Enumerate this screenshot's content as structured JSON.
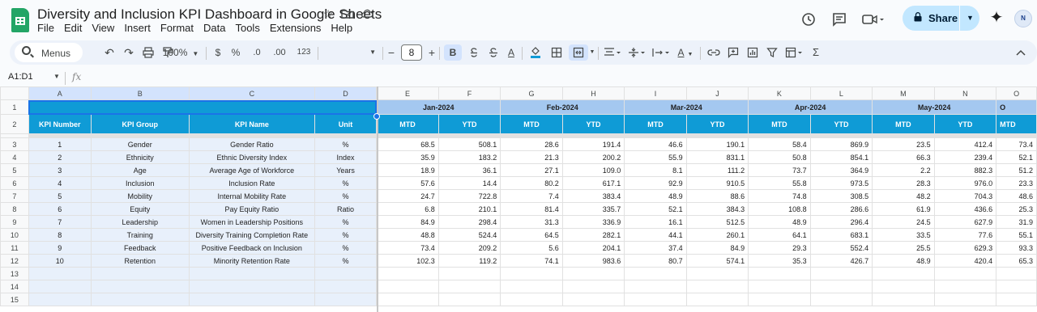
{
  "document": {
    "title": "Diversity and Inclusion KPI Dashboard in Google Sheets"
  },
  "menu": [
    "File",
    "Edit",
    "View",
    "Insert",
    "Format",
    "Data",
    "Tools",
    "Extensions",
    "Help"
  ],
  "share": {
    "label": "Share"
  },
  "avatar": {
    "initials": "N"
  },
  "toolbar": {
    "search_label": "Menus",
    "zoom": "100%",
    "currency": "$",
    "percent": "%",
    "decrease_decimal": ".0",
    "increase_decimal": ".00",
    "number_format": "123",
    "font_size": "8",
    "minus": "−",
    "plus": "+",
    "bold": "B",
    "text_color": "A"
  },
  "formula_bar": {
    "name_box": "A1:D1",
    "fx": "fx"
  },
  "columns": [
    "A",
    "B",
    "C",
    "D",
    "E",
    "F",
    "G",
    "H",
    "I",
    "J",
    "K",
    "L",
    "M",
    "N",
    "O"
  ],
  "months": [
    "Jan-2024",
    "Feb-2024",
    "Mar-2024",
    "Apr-2024",
    "May-2024"
  ],
  "headers": {
    "kpi_number": "KPI Number",
    "kpi_group": "KPI Group",
    "kpi_name": "KPI Name",
    "unit": "Unit",
    "mtd": "MTD",
    "ytd": "YTD"
  },
  "row_numbers": [
    "1",
    "2",
    "3",
    "4",
    "5",
    "6",
    "7",
    "8",
    "9",
    "10",
    "11",
    "12",
    "13",
    "14",
    "15"
  ],
  "rows": [
    {
      "no": "1",
      "group": "Gender",
      "name": "Gender Ratio",
      "unit": "%",
      "vals": [
        "68.5",
        "508.1",
        "28.6",
        "191.4",
        "46.6",
        "190.1",
        "58.4",
        "869.9",
        "23.5",
        "412.4",
        "73.4"
      ]
    },
    {
      "no": "2",
      "group": "Ethnicity",
      "name": "Ethnic Diversity Index",
      "unit": "Index",
      "vals": [
        "35.9",
        "183.2",
        "21.3",
        "200.2",
        "55.9",
        "831.1",
        "50.8",
        "854.1",
        "66.3",
        "239.4",
        "52.1"
      ]
    },
    {
      "no": "3",
      "group": "Age",
      "name": "Average Age of Workforce",
      "unit": "Years",
      "vals": [
        "18.9",
        "36.1",
        "27.1",
        "109.0",
        "8.1",
        "111.2",
        "73.7",
        "364.9",
        "2.2",
        "882.3",
        "51.2"
      ]
    },
    {
      "no": "4",
      "group": "Inclusion",
      "name": "Inclusion Rate",
      "unit": "%",
      "vals": [
        "57.6",
        "14.4",
        "80.2",
        "617.1",
        "92.9",
        "910.5",
        "55.8",
        "973.5",
        "28.3",
        "976.0",
        "23.3"
      ]
    },
    {
      "no": "5",
      "group": "Mobility",
      "name": "Internal Mobility Rate",
      "unit": "%",
      "vals": [
        "24.7",
        "722.8",
        "7.4",
        "383.4",
        "48.9",
        "88.6",
        "74.8",
        "308.5",
        "48.2",
        "704.3",
        "48.6"
      ]
    },
    {
      "no": "6",
      "group": "Equity",
      "name": "Pay Equity Ratio",
      "unit": "Ratio",
      "vals": [
        "6.8",
        "210.1",
        "81.4",
        "335.7",
        "52.1",
        "384.3",
        "108.8",
        "286.6",
        "61.9",
        "436.6",
        "25.3"
      ]
    },
    {
      "no": "7",
      "group": "Leadership",
      "name": "Women in Leadership Positions",
      "unit": "%",
      "vals": [
        "84.9",
        "298.4",
        "31.3",
        "336.9",
        "16.1",
        "512.5",
        "48.9",
        "296.4",
        "24.5",
        "627.9",
        "31.9"
      ]
    },
    {
      "no": "8",
      "group": "Training",
      "name": "Diversity Training Completion Rate",
      "unit": "%",
      "vals": [
        "48.8",
        "524.4",
        "64.5",
        "282.1",
        "44.1",
        "260.1",
        "64.1",
        "683.1",
        "33.5",
        "77.6",
        "55.1"
      ]
    },
    {
      "no": "9",
      "group": "Feedback",
      "name": "Positive Feedback on Inclusion",
      "unit": "%",
      "vals": [
        "73.4",
        "209.2",
        "5.6",
        "204.1",
        "37.4",
        "84.9",
        "29.3",
        "552.4",
        "25.5",
        "629.3",
        "93.3"
      ]
    },
    {
      "no": "10",
      "group": "Retention",
      "name": "Minority Retention Rate",
      "unit": "%",
      "vals": [
        "102.3",
        "119.2",
        "74.1",
        "983.6",
        "80.7",
        "574.1",
        "35.3",
        "426.7",
        "48.9",
        "420.4",
        "65.3"
      ]
    }
  ]
}
